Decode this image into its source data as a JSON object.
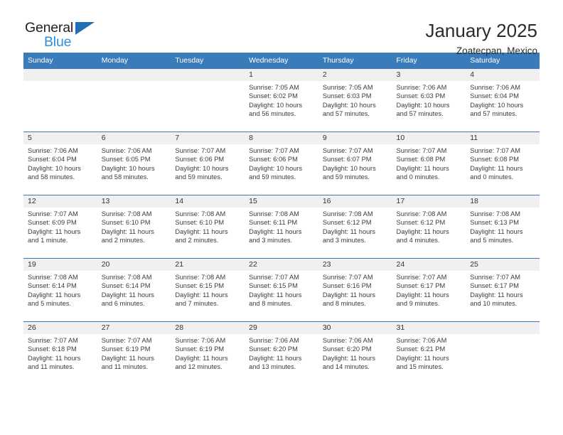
{
  "brand": {
    "name_top": "General",
    "name_bottom": "Blue",
    "triangle_color": "#1f6fb5",
    "blue_text_color": "#2b8fdd"
  },
  "header": {
    "title": "January 2025",
    "subtitle": "Zoatecpan, Mexico"
  },
  "theme": {
    "header_bg": "#3a7cba",
    "daynum_bg": "#f0f0f0",
    "row_divider": "#3a7cba"
  },
  "weekday_headers": [
    "Sunday",
    "Monday",
    "Tuesday",
    "Wednesday",
    "Thursday",
    "Friday",
    "Saturday"
  ],
  "labels": {
    "sunrise": "Sunrise:",
    "sunset": "Sunset:",
    "daylight": "Daylight:"
  },
  "weeks": [
    [
      {
        "day": ""
      },
      {
        "day": ""
      },
      {
        "day": ""
      },
      {
        "day": "1",
        "sunrise": "Sunrise: 7:05 AM",
        "sunset": "Sunset: 6:02 PM",
        "daylight_line1": "Daylight: 10 hours",
        "daylight_line2": "and 56 minutes."
      },
      {
        "day": "2",
        "sunrise": "Sunrise: 7:05 AM",
        "sunset": "Sunset: 6:03 PM",
        "daylight_line1": "Daylight: 10 hours",
        "daylight_line2": "and 57 minutes."
      },
      {
        "day": "3",
        "sunrise": "Sunrise: 7:06 AM",
        "sunset": "Sunset: 6:03 PM",
        "daylight_line1": "Daylight: 10 hours",
        "daylight_line2": "and 57 minutes."
      },
      {
        "day": "4",
        "sunrise": "Sunrise: 7:06 AM",
        "sunset": "Sunset: 6:04 PM",
        "daylight_line1": "Daylight: 10 hours",
        "daylight_line2": "and 57 minutes."
      }
    ],
    [
      {
        "day": "5",
        "sunrise": "Sunrise: 7:06 AM",
        "sunset": "Sunset: 6:04 PM",
        "daylight_line1": "Daylight: 10 hours",
        "daylight_line2": "and 58 minutes."
      },
      {
        "day": "6",
        "sunrise": "Sunrise: 7:06 AM",
        "sunset": "Sunset: 6:05 PM",
        "daylight_line1": "Daylight: 10 hours",
        "daylight_line2": "and 58 minutes."
      },
      {
        "day": "7",
        "sunrise": "Sunrise: 7:07 AM",
        "sunset": "Sunset: 6:06 PM",
        "daylight_line1": "Daylight: 10 hours",
        "daylight_line2": "and 59 minutes."
      },
      {
        "day": "8",
        "sunrise": "Sunrise: 7:07 AM",
        "sunset": "Sunset: 6:06 PM",
        "daylight_line1": "Daylight: 10 hours",
        "daylight_line2": "and 59 minutes."
      },
      {
        "day": "9",
        "sunrise": "Sunrise: 7:07 AM",
        "sunset": "Sunset: 6:07 PM",
        "daylight_line1": "Daylight: 10 hours",
        "daylight_line2": "and 59 minutes."
      },
      {
        "day": "10",
        "sunrise": "Sunrise: 7:07 AM",
        "sunset": "Sunset: 6:08 PM",
        "daylight_line1": "Daylight: 11 hours",
        "daylight_line2": "and 0 minutes."
      },
      {
        "day": "11",
        "sunrise": "Sunrise: 7:07 AM",
        "sunset": "Sunset: 6:08 PM",
        "daylight_line1": "Daylight: 11 hours",
        "daylight_line2": "and 0 minutes."
      }
    ],
    [
      {
        "day": "12",
        "sunrise": "Sunrise: 7:07 AM",
        "sunset": "Sunset: 6:09 PM",
        "daylight_line1": "Daylight: 11 hours",
        "daylight_line2": "and 1 minute."
      },
      {
        "day": "13",
        "sunrise": "Sunrise: 7:08 AM",
        "sunset": "Sunset: 6:10 PM",
        "daylight_line1": "Daylight: 11 hours",
        "daylight_line2": "and 2 minutes."
      },
      {
        "day": "14",
        "sunrise": "Sunrise: 7:08 AM",
        "sunset": "Sunset: 6:10 PM",
        "daylight_line1": "Daylight: 11 hours",
        "daylight_line2": "and 2 minutes."
      },
      {
        "day": "15",
        "sunrise": "Sunrise: 7:08 AM",
        "sunset": "Sunset: 6:11 PM",
        "daylight_line1": "Daylight: 11 hours",
        "daylight_line2": "and 3 minutes."
      },
      {
        "day": "16",
        "sunrise": "Sunrise: 7:08 AM",
        "sunset": "Sunset: 6:12 PM",
        "daylight_line1": "Daylight: 11 hours",
        "daylight_line2": "and 3 minutes."
      },
      {
        "day": "17",
        "sunrise": "Sunrise: 7:08 AM",
        "sunset": "Sunset: 6:12 PM",
        "daylight_line1": "Daylight: 11 hours",
        "daylight_line2": "and 4 minutes."
      },
      {
        "day": "18",
        "sunrise": "Sunrise: 7:08 AM",
        "sunset": "Sunset: 6:13 PM",
        "daylight_line1": "Daylight: 11 hours",
        "daylight_line2": "and 5 minutes."
      }
    ],
    [
      {
        "day": "19",
        "sunrise": "Sunrise: 7:08 AM",
        "sunset": "Sunset: 6:14 PM",
        "daylight_line1": "Daylight: 11 hours",
        "daylight_line2": "and 5 minutes."
      },
      {
        "day": "20",
        "sunrise": "Sunrise: 7:08 AM",
        "sunset": "Sunset: 6:14 PM",
        "daylight_line1": "Daylight: 11 hours",
        "daylight_line2": "and 6 minutes."
      },
      {
        "day": "21",
        "sunrise": "Sunrise: 7:08 AM",
        "sunset": "Sunset: 6:15 PM",
        "daylight_line1": "Daylight: 11 hours",
        "daylight_line2": "and 7 minutes."
      },
      {
        "day": "22",
        "sunrise": "Sunrise: 7:07 AM",
        "sunset": "Sunset: 6:15 PM",
        "daylight_line1": "Daylight: 11 hours",
        "daylight_line2": "and 8 minutes."
      },
      {
        "day": "23",
        "sunrise": "Sunrise: 7:07 AM",
        "sunset": "Sunset: 6:16 PM",
        "daylight_line1": "Daylight: 11 hours",
        "daylight_line2": "and 8 minutes."
      },
      {
        "day": "24",
        "sunrise": "Sunrise: 7:07 AM",
        "sunset": "Sunset: 6:17 PM",
        "daylight_line1": "Daylight: 11 hours",
        "daylight_line2": "and 9 minutes."
      },
      {
        "day": "25",
        "sunrise": "Sunrise: 7:07 AM",
        "sunset": "Sunset: 6:17 PM",
        "daylight_line1": "Daylight: 11 hours",
        "daylight_line2": "and 10 minutes."
      }
    ],
    [
      {
        "day": "26",
        "sunrise": "Sunrise: 7:07 AM",
        "sunset": "Sunset: 6:18 PM",
        "daylight_line1": "Daylight: 11 hours",
        "daylight_line2": "and 11 minutes."
      },
      {
        "day": "27",
        "sunrise": "Sunrise: 7:07 AM",
        "sunset": "Sunset: 6:19 PM",
        "daylight_line1": "Daylight: 11 hours",
        "daylight_line2": "and 11 minutes."
      },
      {
        "day": "28",
        "sunrise": "Sunrise: 7:06 AM",
        "sunset": "Sunset: 6:19 PM",
        "daylight_line1": "Daylight: 11 hours",
        "daylight_line2": "and 12 minutes."
      },
      {
        "day": "29",
        "sunrise": "Sunrise: 7:06 AM",
        "sunset": "Sunset: 6:20 PM",
        "daylight_line1": "Daylight: 11 hours",
        "daylight_line2": "and 13 minutes."
      },
      {
        "day": "30",
        "sunrise": "Sunrise: 7:06 AM",
        "sunset": "Sunset: 6:20 PM",
        "daylight_line1": "Daylight: 11 hours",
        "daylight_line2": "and 14 minutes."
      },
      {
        "day": "31",
        "sunrise": "Sunrise: 7:06 AM",
        "sunset": "Sunset: 6:21 PM",
        "daylight_line1": "Daylight: 11 hours",
        "daylight_line2": "and 15 minutes."
      },
      {
        "day": ""
      }
    ]
  ]
}
